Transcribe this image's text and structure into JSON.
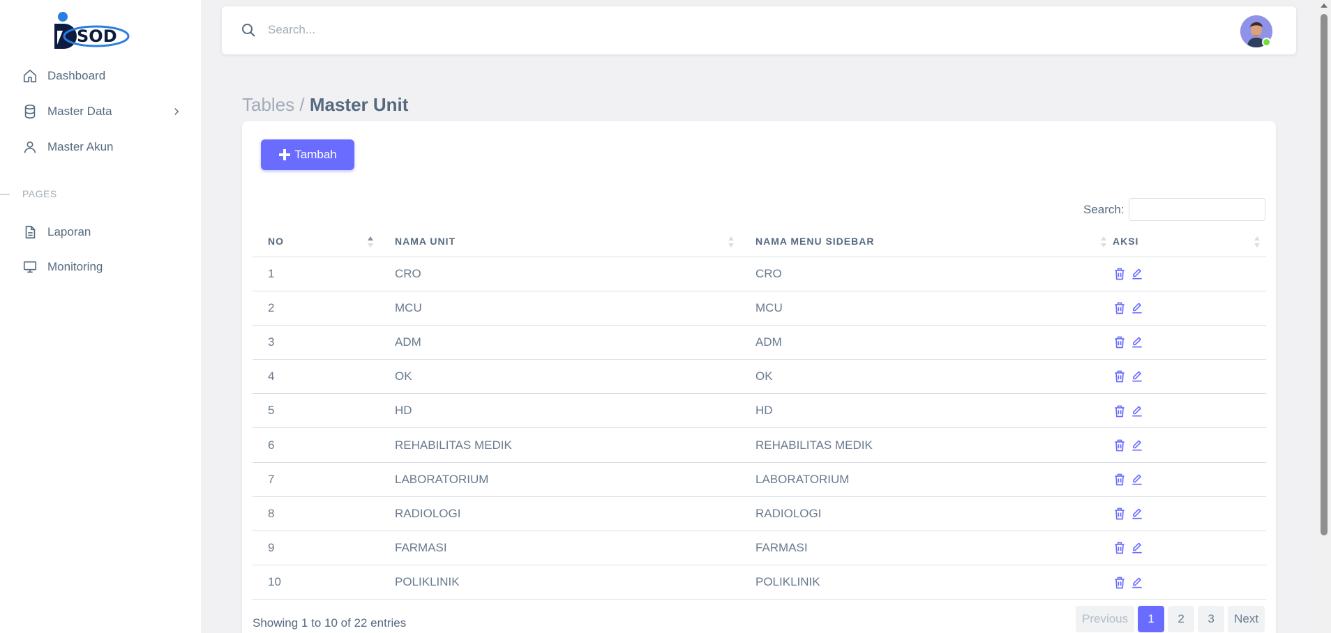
{
  "sidebar": {
    "logo_text": "SOD",
    "items": [
      {
        "label": "Dashboard",
        "icon": "home-icon"
      },
      {
        "label": "Master Data",
        "icon": "database-icon"
      },
      {
        "label": "Master Akun",
        "icon": "user-icon"
      }
    ],
    "section_label": "PAGES",
    "pages": [
      {
        "label": "Laporan",
        "icon": "document-icon"
      },
      {
        "label": "Monitoring",
        "icon": "monitor-icon"
      }
    ]
  },
  "header": {
    "search_placeholder": "Search..."
  },
  "breadcrumb": {
    "parent": "Tables /",
    "current": "Master Unit"
  },
  "toolbar": {
    "add_label": "Tambah"
  },
  "table": {
    "search_label": "Search:",
    "columns": [
      "NO",
      "NAMA UNIT",
      "NAMA MENU SIDEBAR",
      "AKSI"
    ],
    "rows": [
      {
        "no": "1",
        "unit": "CRO",
        "menu": "CRO"
      },
      {
        "no": "2",
        "unit": "MCU",
        "menu": "MCU"
      },
      {
        "no": "3",
        "unit": "ADM",
        "menu": "ADM"
      },
      {
        "no": "4",
        "unit": "OK",
        "menu": "OK"
      },
      {
        "no": "5",
        "unit": "HD",
        "menu": "HD"
      },
      {
        "no": "6",
        "unit": "REHABILITAS MEDIK",
        "menu": "REHABILITAS MEDIK"
      },
      {
        "no": "7",
        "unit": "LABORATORIUM",
        "menu": "LABORATORIUM"
      },
      {
        "no": "8",
        "unit": "RADIOLOGI",
        "menu": "RADIOLOGI"
      },
      {
        "no": "9",
        "unit": "FARMASI",
        "menu": "FARMASI"
      },
      {
        "no": "10",
        "unit": "POLIKLINIK",
        "menu": "POLIKLINIK"
      }
    ],
    "info": "Showing 1 to 10 of 22 entries",
    "pagination": {
      "previous": "Previous",
      "pages": [
        "1",
        "2",
        "3"
      ],
      "active": "1",
      "next": "Next"
    }
  },
  "colors": {
    "accent": "#696cff",
    "text": "#566a7f",
    "muted": "#a1acb8",
    "background": "#f1f1f4",
    "online": "#71dd37"
  }
}
